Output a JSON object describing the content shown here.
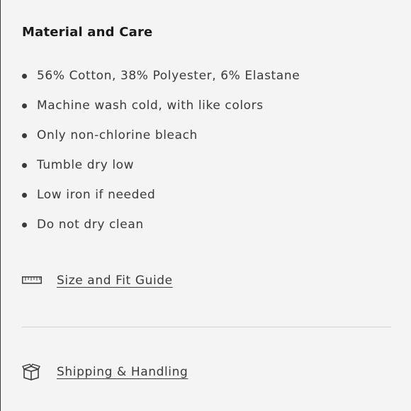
{
  "section": {
    "title": "Material and Care"
  },
  "care_items": [
    "56% Cotton, 38% Polyester, 6% Elastane",
    "Machine wash cold, with like colors",
    "Only non-chlorine bleach",
    "Tumble dry low",
    "Low iron if needed",
    "Do not dry clean"
  ],
  "links": {
    "size_guide": {
      "label": "Size and Fit Guide",
      "icon": "ruler-icon"
    },
    "shipping": {
      "label": "Shipping & Handling",
      "icon": "box-icon"
    }
  },
  "colors": {
    "text": "#3a3a3a",
    "title": "#1a1a1a",
    "background": "#f4f4f4",
    "divider": "#d2d2d2"
  }
}
